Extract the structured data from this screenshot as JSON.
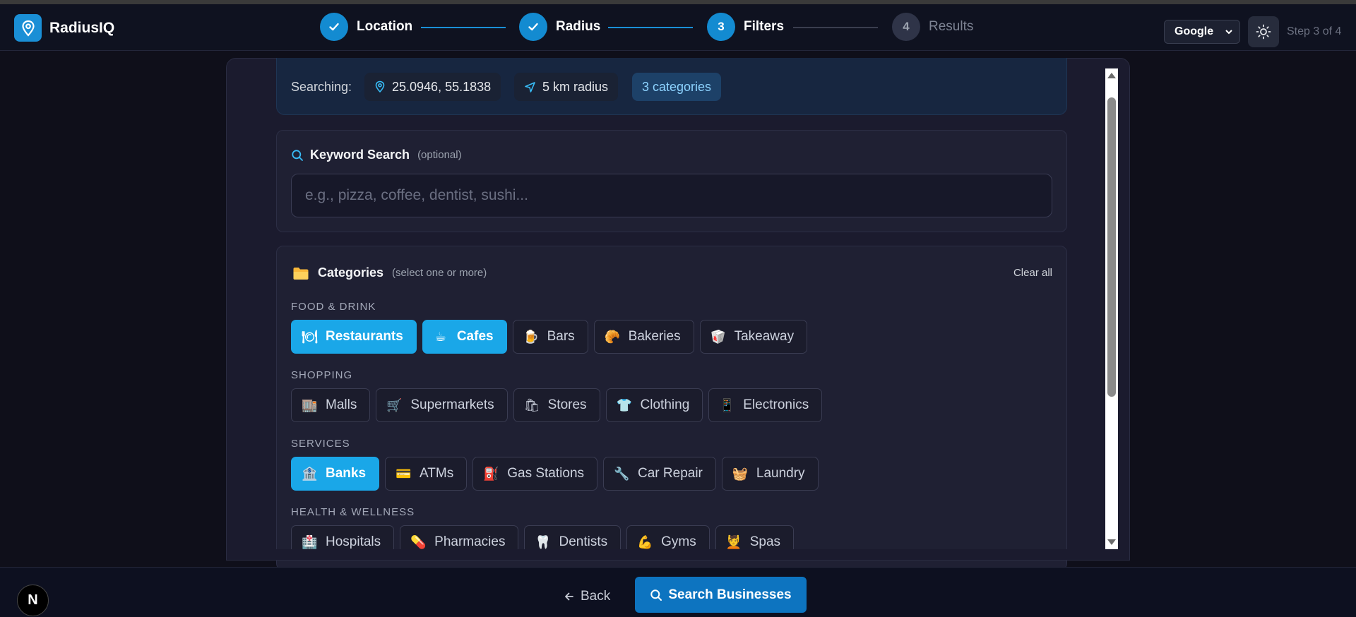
{
  "app": {
    "name": "RadiusIQ"
  },
  "steps": [
    {
      "label": "Location",
      "number": "1",
      "state": "done"
    },
    {
      "label": "Radius",
      "number": "2",
      "state": "done"
    },
    {
      "label": "Filters",
      "number": "3",
      "state": "active"
    },
    {
      "label": "Results",
      "number": "4",
      "state": "todo"
    }
  ],
  "header": {
    "provider": "Google",
    "step_indicator": "Step 3 of 4"
  },
  "searching": {
    "label": "Searching:",
    "coordinates": "25.0946, 55.1838",
    "radius": "5 km radius",
    "categories": "3 categories"
  },
  "keyword": {
    "title": "Keyword Search",
    "optional": "(optional)",
    "placeholder": "e.g., pizza, coffee, dentist, sushi...",
    "value": ""
  },
  "categories": {
    "title": "Categories",
    "hint": "(select one or more)",
    "clear_all": "Clear all",
    "sections": [
      {
        "name": "FOOD & DRINK",
        "items": [
          {
            "label": "Restaurants",
            "icon": "🍽",
            "selected": true
          },
          {
            "label": "Cafes",
            "icon": "☕",
            "selected": true
          },
          {
            "label": "Bars",
            "icon": "🍺",
            "selected": false
          },
          {
            "label": "Bakeries",
            "icon": "🥐",
            "selected": false
          },
          {
            "label": "Takeaway",
            "icon": "🥡",
            "selected": false
          }
        ]
      },
      {
        "name": "SHOPPING",
        "items": [
          {
            "label": "Malls",
            "icon": "🏬",
            "selected": false
          },
          {
            "label": "Supermarkets",
            "icon": "🛒",
            "selected": false
          },
          {
            "label": "Stores",
            "icon": "🛍",
            "selected": false
          },
          {
            "label": "Clothing",
            "icon": "👕",
            "selected": false
          },
          {
            "label": "Electronics",
            "icon": "📱",
            "selected": false
          }
        ]
      },
      {
        "name": "SERVICES",
        "items": [
          {
            "label": "Banks",
            "icon": "🏦",
            "selected": true
          },
          {
            "label": "ATMs",
            "icon": "💳",
            "selected": false
          },
          {
            "label": "Gas Stations",
            "icon": "⛽",
            "selected": false
          },
          {
            "label": "Car Repair",
            "icon": "🔧",
            "selected": false
          },
          {
            "label": "Laundry",
            "icon": "🧺",
            "selected": false
          }
        ]
      },
      {
        "name": "HEALTH & WELLNESS",
        "items": [
          {
            "label": "Hospitals",
            "icon": "🏥",
            "selected": false
          },
          {
            "label": "Pharmacies",
            "icon": "💊",
            "selected": false
          },
          {
            "label": "Dentists",
            "icon": "🦷",
            "selected": false
          },
          {
            "label": "Gyms",
            "icon": "💪",
            "selected": false
          },
          {
            "label": "Spas",
            "icon": "💆",
            "selected": false
          }
        ]
      }
    ]
  },
  "footer": {
    "back": "Back",
    "search": "Search Businesses",
    "badge": "N"
  },
  "colors": {
    "accent": "#138bd1",
    "selected": "#1aa7e8",
    "background": "#0f0f1a",
    "panel": "#1b1b2e"
  }
}
